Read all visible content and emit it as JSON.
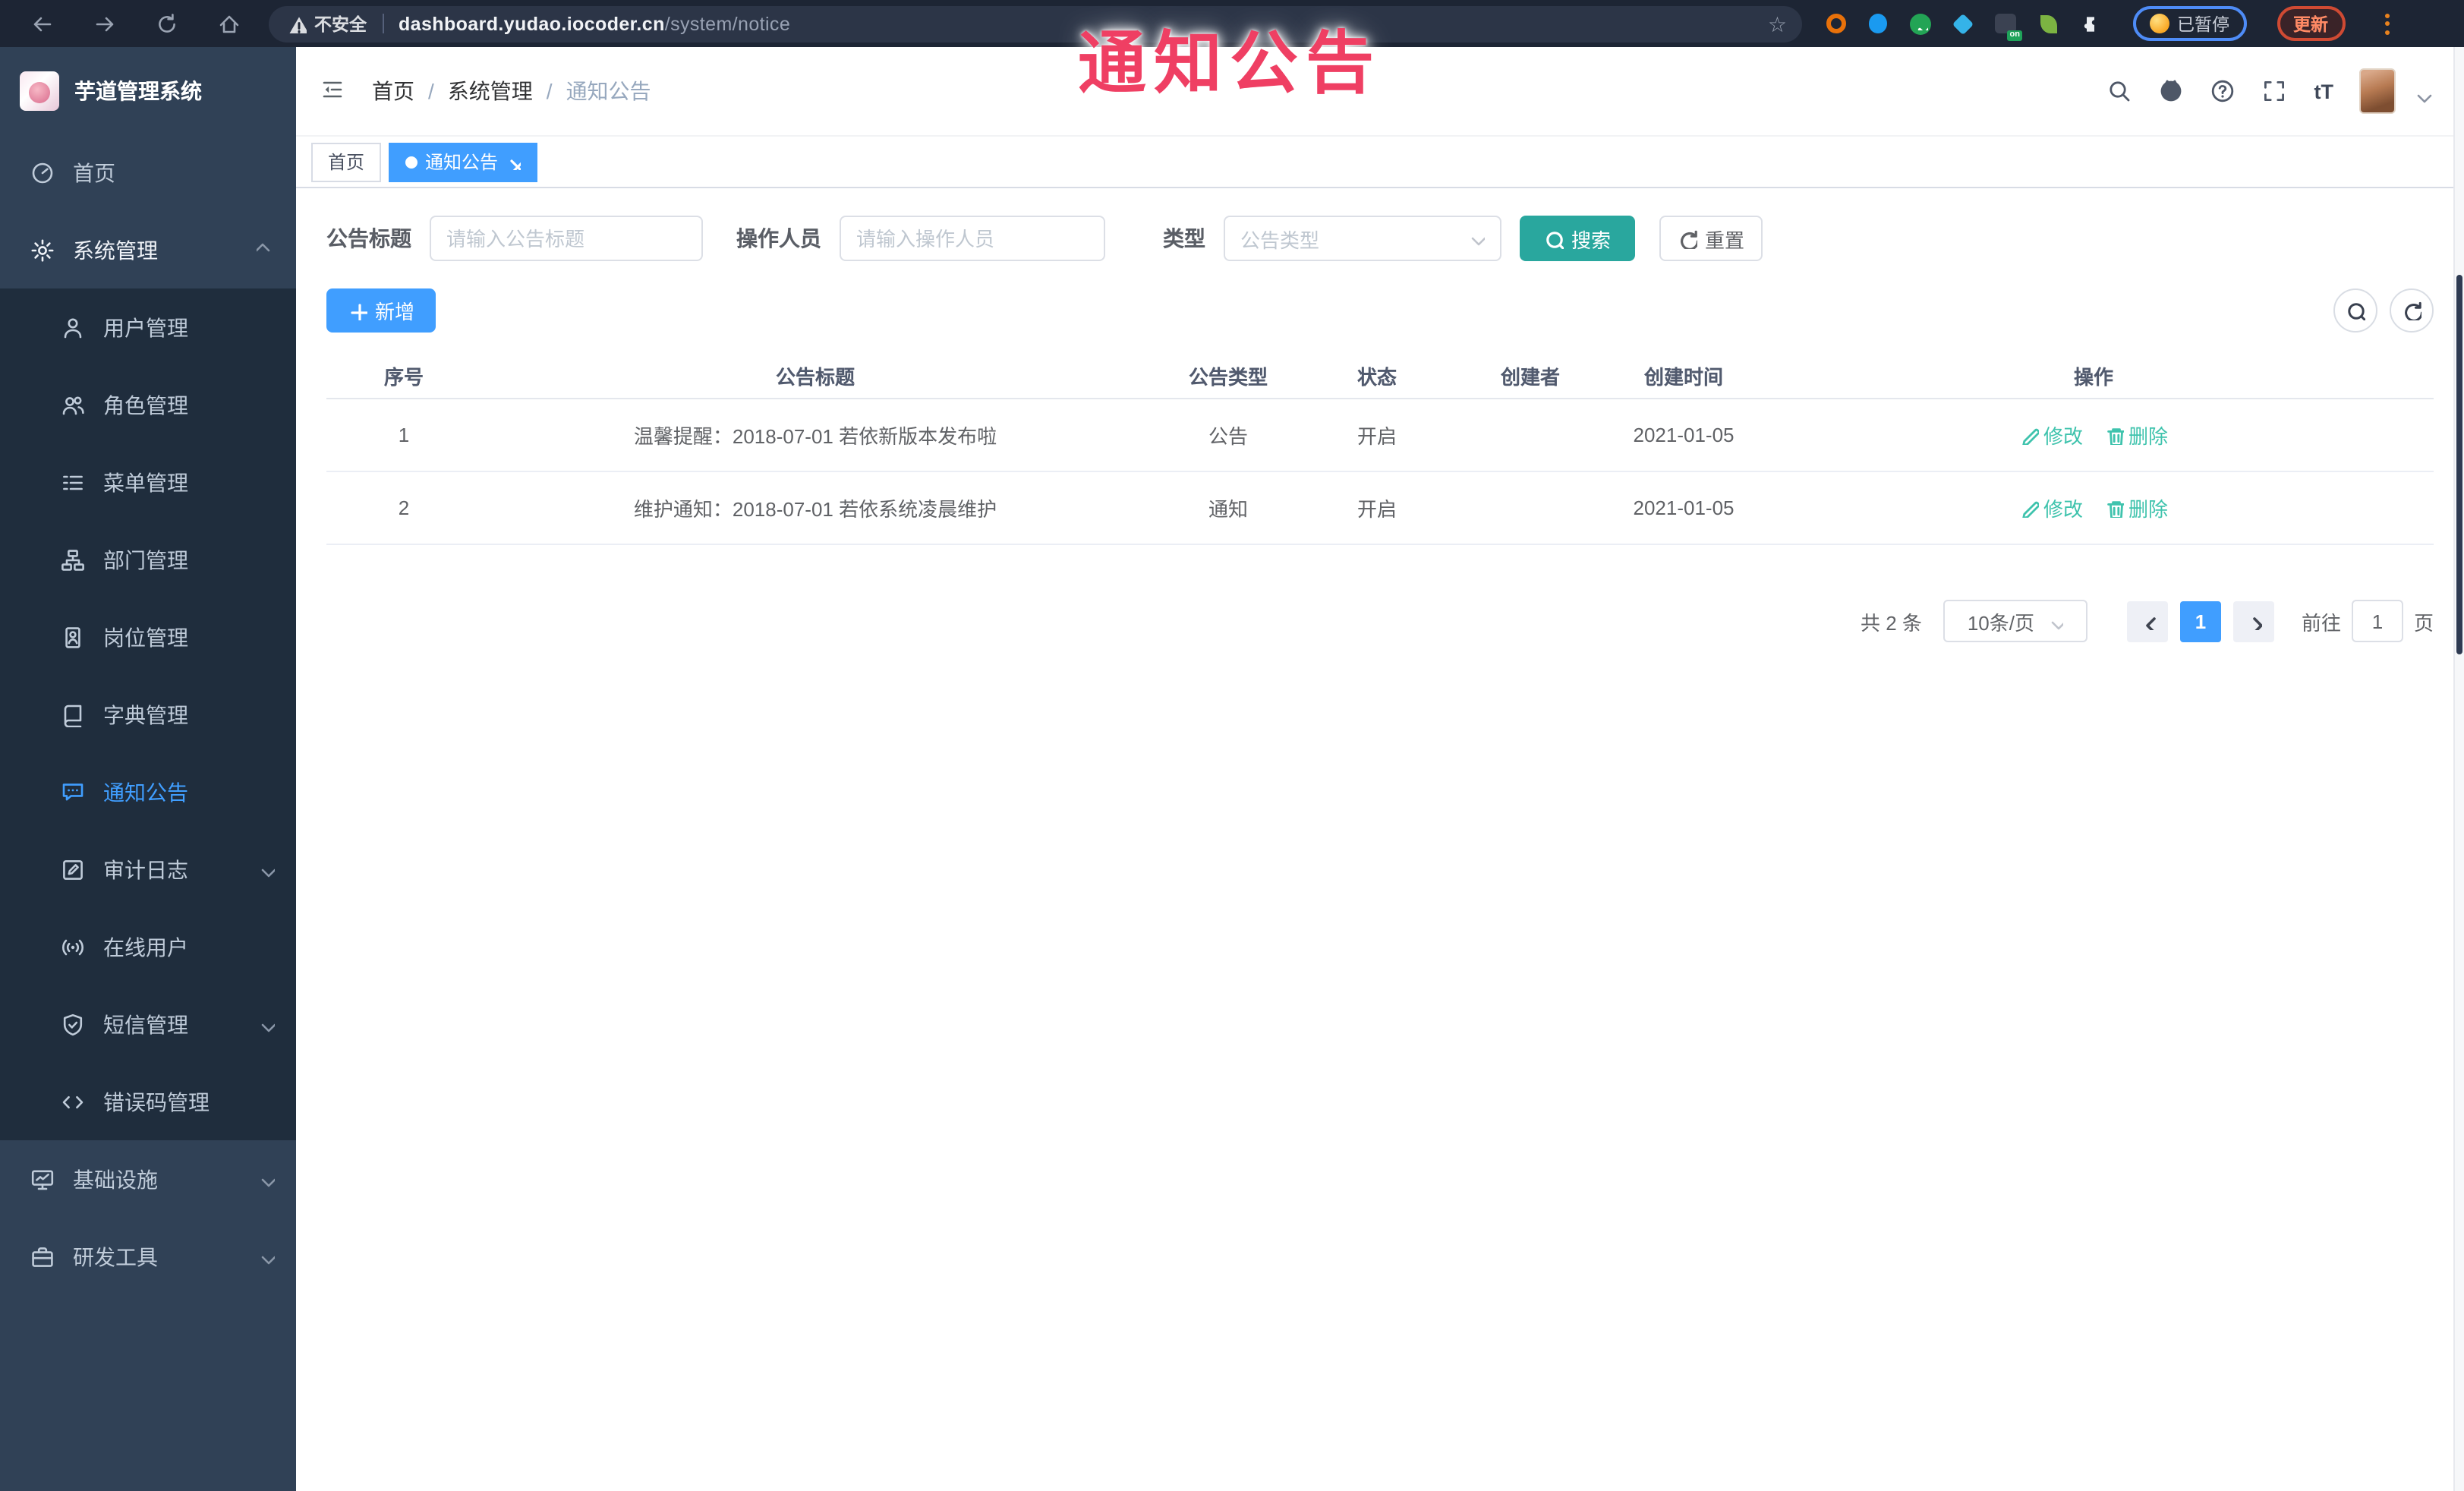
{
  "colors": {
    "accent": "#409eff",
    "button_teal": "#29a79e",
    "link_teal": "#3fc3ad",
    "watermark_red": "#ef3f63",
    "sidebar_bg": "#304156",
    "submenu_bg": "#1f2d3d"
  },
  "browser": {
    "security_label": "不安全",
    "url_host": "dashboard.yudao.iocoder.cn",
    "url_path": "/system/notice",
    "paused_label": "已暂停",
    "update_label": "更新"
  },
  "watermark": {
    "text": "通知公告"
  },
  "sidebar": {
    "title": "芋道管理系统",
    "items_top": [
      {
        "label": "首页",
        "icon": "gauge-icon"
      },
      {
        "label": "系统管理",
        "icon": "gear-icon"
      }
    ],
    "items_sub": [
      {
        "label": "用户管理",
        "icon": "user-icon"
      },
      {
        "label": "角色管理",
        "icon": "users-icon"
      },
      {
        "label": "菜单管理",
        "icon": "menu-tree-icon"
      },
      {
        "label": "部门管理",
        "icon": "org-chart-icon"
      },
      {
        "label": "岗位管理",
        "icon": "id-badge-icon"
      },
      {
        "label": "字典管理",
        "icon": "book-icon"
      },
      {
        "label": "通知公告",
        "icon": "chat-bubble-icon"
      },
      {
        "label": "审计日志",
        "icon": "edit-log-icon"
      },
      {
        "label": "在线用户",
        "icon": "broadcast-icon"
      },
      {
        "label": "短信管理",
        "icon": "shield-icon"
      },
      {
        "label": "错误码管理",
        "icon": "code-icon"
      }
    ],
    "items_bottom": [
      {
        "label": "基础设施",
        "icon": "monitor-icon"
      },
      {
        "label": "研发工具",
        "icon": "toolbox-icon"
      }
    ]
  },
  "header": {
    "breadcrumb": [
      "首页",
      "系统管理",
      "通知公告"
    ],
    "separator": "/",
    "font_icon_label": "tT"
  },
  "tabs": [
    {
      "label": "首页"
    },
    {
      "label": "通知公告"
    }
  ],
  "filters": {
    "title_label": "公告标题",
    "title_placeholder": "请输入公告标题",
    "operator_label": "操作人员",
    "operator_placeholder": "请输入操作人员",
    "type_label": "类型",
    "type_placeholder": "公告类型",
    "search_label": "搜索",
    "reset_label": "重置"
  },
  "toolbar": {
    "add_label": "新增"
  },
  "table": {
    "headers": [
      "序号",
      "公告标题",
      "公告类型",
      "状态",
      "创建者",
      "创建时间",
      "操作"
    ],
    "rows": [
      {
        "no": "1",
        "title": "温馨提醒：2018-07-01 若依新版本发布啦",
        "type": "公告",
        "status": "开启",
        "creator": "",
        "created": "2021-01-05",
        "edit_label": "修改",
        "delete_label": "删除"
      },
      {
        "no": "2",
        "title": "维护通知：2018-07-01 若依系统凌晨维护",
        "type": "通知",
        "status": "开启",
        "creator": "",
        "created": "2021-01-05",
        "edit_label": "修改",
        "delete_label": "删除"
      }
    ]
  },
  "pagination": {
    "total": "共 2 条",
    "page_size": "10条/页",
    "current_page": "1",
    "goto_label": "前往",
    "goto_value": "1",
    "unit_label": "页"
  }
}
